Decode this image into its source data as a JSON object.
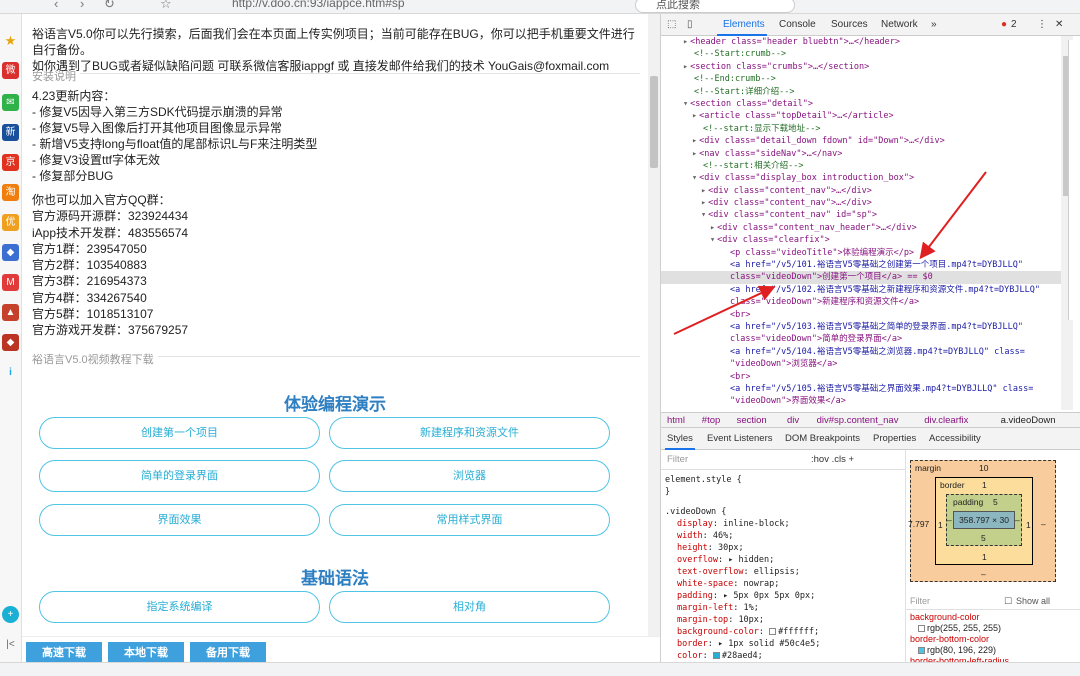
{
  "browser": {
    "url": "http://v.doo.cn:93/iappce.htm#sp",
    "search_text": "点此搜索"
  },
  "page": {
    "intro_line1": "裕语言V5.0你可以先行摸索，后面我们会在本页面上传实例项目；当前可能存在BUG，你可以把手机重要文件进行自行备份。",
    "intro_line2": "如你遇到了BUG或者疑似缺陷问题 可联系微信客服iappgf 或 直接发邮件给我们的技术 YouGais@foxmail.com",
    "install_label": "安装说明",
    "notes": [
      "4.23更新内容：",
      "- 修复V5因导入第三方SDK代码提示崩溃的异常",
      "- 修复V5导入图像后打开其他项目图像显示异常",
      "- 新增V5支持long与float值的尾部标识L与F来注明类型",
      "- 修复V3设置ttf字体无效",
      "- 修复部分BUG"
    ],
    "groups": [
      "你也可以加入官方QQ群：",
      "官方源码开源群：323924434",
      "iApp技术开发群：483556574",
      "官方1群：239547050",
      "官方2群：103540883",
      "官方3群：216954373",
      "官方4群：334267540",
      "官方5群：1018513107",
      "官方游戏开发群：375679257"
    ],
    "video_label": "裕语言V5.0视频教程下载",
    "section1_title": "体验编程演示",
    "section1_buttons": [
      "创建第一个项目",
      "新建程序和资源文件",
      "简单的登录界面",
      "浏览器",
      "界面效果",
      "常用样式界面"
    ],
    "section2_title": "基础语法",
    "section2_buttons": [
      "指定系统编译",
      "相对角"
    ],
    "download_buttons": [
      "高速下载",
      "本地下载",
      "备用下载"
    ]
  },
  "devtools": {
    "tabs": [
      "Elements",
      "Console",
      "Sources",
      "Network",
      "»"
    ],
    "error_count": "2",
    "elements": [
      [
        "▸",
        "<header class=\"header bluebtn\">…</header>"
      ],
      [
        "",
        "<!--Start:crumb-->"
      ],
      [
        "▸",
        "<section class=\"crumbs\">…</section>"
      ],
      [
        "",
        "<!--End:crumb-->"
      ],
      [
        "",
        "<!--Start:详细介绍-->"
      ],
      [
        "▾",
        "<section class=\"detail\">"
      ],
      [
        "▸",
        "<article class=\"topDetail\">…</article>"
      ],
      [
        "",
        "<!--start:显示下载地址-->"
      ],
      [
        "▸",
        "<div class=\"detail_down fdown\" id=\"Down\">…</div>"
      ],
      [
        "▸",
        "<nav class=\"sideNav\">…</nav>"
      ],
      [
        "",
        "<!--start:相关介绍-->"
      ],
      [
        "▾",
        "<div class=\"display_box introduction_box\">"
      ],
      [
        "▸",
        "<div class=\"content_nav\">…</div>"
      ],
      [
        "▸",
        "<div class=\"content_nav\">…</div>"
      ],
      [
        "▾",
        "<div class=\"content_nav\" id=\"sp\">"
      ],
      [
        "▸",
        "<div class=\"content_nav_header\">…</div>"
      ],
      [
        "▾",
        "<div class=\"clearfix\">"
      ],
      [
        "",
        "<p class=\"videoTitle\">体验编程演示</p>"
      ],
      [
        "",
        "<a href=\"/v5/101.裕语言V5零基础之创建第一个项目.mp4?t=DYBJLLQ\""
      ],
      [
        "",
        "class=\"videoDown\">创建第一个项目</a> == $0"
      ],
      [
        "",
        "<a href=\"/v5/102.裕语言V5零基础之新建程序和资源文件.mp4?t=DYBJLLQ\""
      ],
      [
        "",
        "class=\"videoDown\">新建程序和资源文件</a>"
      ],
      [
        "",
        "<br>"
      ],
      [
        "",
        "<a href=\"/v5/103.裕语言V5零基础之简单的登录界面.mp4?t=DYBJLLQ\""
      ],
      [
        "",
        "class=\"videoDown\">简单的登录界面</a>"
      ],
      [
        "",
        "<a href=\"/v5/104.裕语言V5零基础之浏览器.mp4?t=DYBJLLQ\" class="
      ],
      [
        "",
        "\"videoDown\">浏览器</a>"
      ],
      [
        "",
        "<br>"
      ],
      [
        "",
        "<a href=\"/v5/105.裕语言V5零基础之界面效果.mp4?t=DYBJLLQ\" class="
      ],
      [
        "",
        "\"videoDown\">界面效果</a>"
      ]
    ],
    "crumbs": [
      "html",
      "#top",
      "section",
      "div",
      "div#sp.content_nav",
      "div.clearfix",
      "a.videoDown"
    ],
    "subtabs": [
      "Styles",
      "Event Listeners",
      "DOM Breakpoints",
      "Properties",
      "Accessibility"
    ],
    "filter_placeholder": "Filter",
    "hov_cls": ":hov  .cls  +",
    "element_style": "element.style {",
    "element_style_close": "}",
    "rule_selector": ".videoDown {",
    "styles": [
      [
        "display",
        "inline-block;"
      ],
      [
        "width",
        "46%;"
      ],
      [
        "height",
        "30px;"
      ],
      [
        "overflow",
        "▸ hidden;"
      ],
      [
        "text-overflow",
        "ellipsis;"
      ],
      [
        "white-space",
        "nowrap;"
      ],
      [
        "padding",
        "▸ 5px 0px 5px 0px;"
      ],
      [
        "margin-left",
        "1%;"
      ],
      [
        "margin-top",
        "10px;"
      ],
      [
        "background-color",
        "#ffffff;"
      ],
      [
        "border",
        "▸ 1px solid #50c4e5;"
      ],
      [
        "color",
        "#28aed4;"
      ],
      [
        "text-align",
        "center;"
      ],
      [
        "font-size",
        "13px;"
      ],
      [
        "line-height",
        "30px;"
      ]
    ],
    "boxmodel": {
      "margin_label": "margin",
      "margin_top": "10",
      "margin_left": "7.797",
      "margin_right": "–",
      "margin_bottom": "–",
      "border_label": "border",
      "border_val": "1",
      "border_left": "1",
      "border_right": "1",
      "border_bottom": "1",
      "padding_label": "padding",
      "padding_top": "5",
      "padding_left": "–",
      "padding_right": "–",
      "padding_bottom": "5",
      "content": "358.797 × 30"
    },
    "computed_filter": "Filter",
    "show_all": "Show all",
    "computed": [
      [
        "background-color",
        "rgb(255, 255, 255)",
        "#ffffff"
      ],
      [
        "border-bottom-color",
        "rgb(80, 196, 229)",
        "#50c4e5"
      ],
      [
        "border-bottom-left-radius",
        "",
        ""
      ]
    ]
  },
  "colors": {
    "accent": "#28aed4",
    "button_border": "#50c4e5",
    "section_title": "#2e7fc2",
    "download_bg": "#3ea0dd",
    "arrow": "#e02020"
  }
}
